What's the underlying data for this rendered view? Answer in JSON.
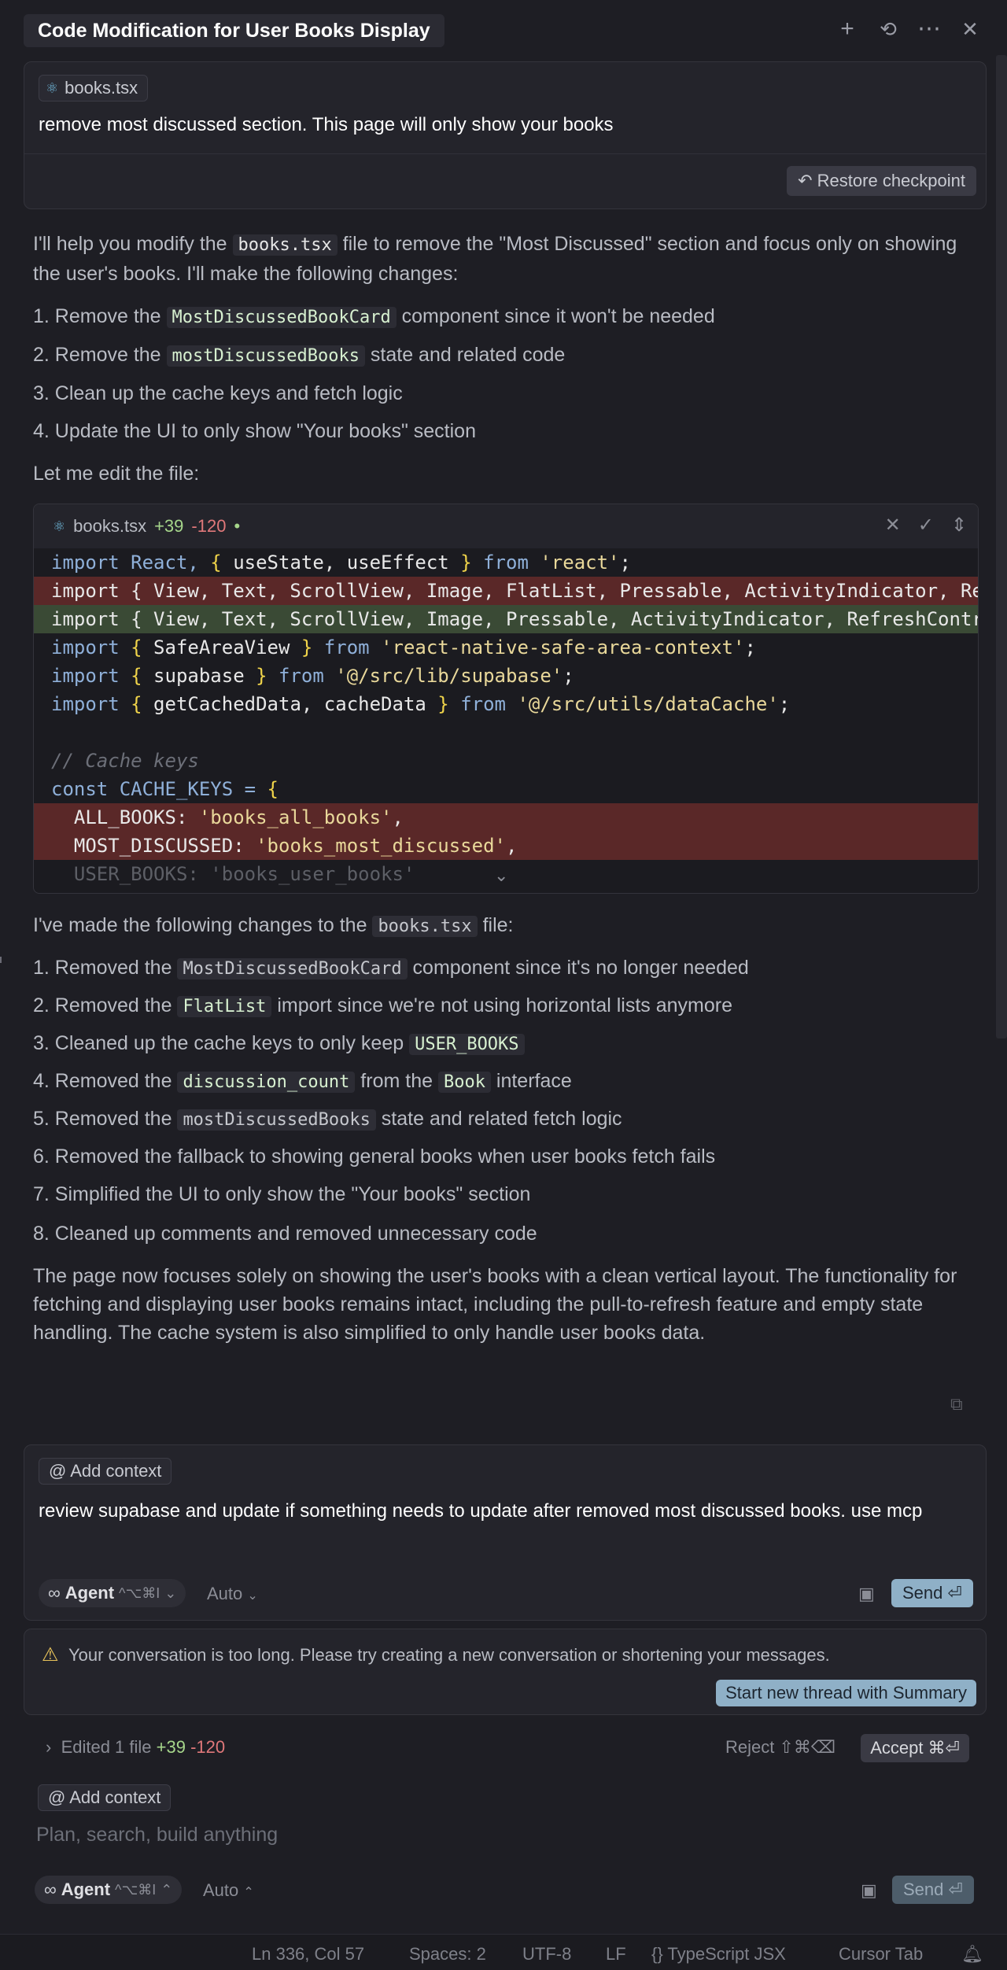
{
  "header": {
    "title": "Code Modification for User Books Display",
    "icons": [
      "plus-icon",
      "history-icon",
      "more-icon",
      "close-icon"
    ]
  },
  "user_message": {
    "file_chip": "books.tsx",
    "text": "remove most discussed section. This page will only show your books",
    "restore_label": "Restore checkpoint"
  },
  "assistant_intro": {
    "p1_a": "I'll help you modify the ",
    "p1_code": "books.tsx",
    "p1_b": " file to remove the \"Most Discussed\" section and focus only on showing the user's books. I'll make the following changes:",
    "steps": [
      {
        "n": "1. ",
        "a": "Remove the ",
        "code": "MostDiscussedBookCard",
        "b": " component since it won't be needed"
      },
      {
        "n": "2. ",
        "a": "Remove the ",
        "code": "mostDiscussedBooks",
        "b": " state and related code"
      },
      {
        "n": "3. ",
        "a": "Clean up the cache keys and fetch logic",
        "code": "",
        "b": ""
      },
      {
        "n": "4. ",
        "a": "Update the UI to only show \"Your books\" section",
        "code": "",
        "b": ""
      }
    ],
    "edit_intro": "Let me edit the file:"
  },
  "code_block": {
    "filename": "books.tsx",
    "added": "+39",
    "removed": "-120",
    "dot": "•",
    "lines": {
      "l1_a": "import React, ",
      "l1_b": "{",
      "l1_c": " useState, useEffect ",
      "l1_d": "}",
      "l1_e": " from ",
      "l1_f": "'react'",
      "l1_g": ";",
      "l2": "import { View, Text, ScrollView, Image, FlatList, Pressable, ActivityIndicator, Re",
      "l3": "import { View, Text, ScrollView, Image, Pressable, ActivityIndicator, RefreshContr",
      "l4_a": "import ",
      "l4_b": "{",
      "l4_c": " SafeAreaView ",
      "l4_d": "}",
      "l4_e": " from ",
      "l4_f": "'react-native-safe-area-context'",
      "l4_g": ";",
      "l5_a": "import ",
      "l5_b": "{",
      "l5_c": " supabase ",
      "l5_d": "}",
      "l5_e": " from ",
      "l5_f": "'@/src/lib/supabase'",
      "l5_g": ";",
      "l6_a": "import ",
      "l6_b": "{",
      "l6_c": " getCachedData, cacheData ",
      "l6_d": "}",
      "l6_e": " from ",
      "l6_f": "'@/src/utils/dataCache'",
      "l6_g": ";",
      "l8": "// Cache keys",
      "l9_a": "const CACHE_KEYS = ",
      "l9_b": "{",
      "l10_a": "  ALL_BOOKS: ",
      "l10_b": "'books_all_books'",
      "l10_c": ",",
      "l11_a": "  MOST_DISCUSSED: ",
      "l11_b": "'books_most_discussed'",
      "l11_c": ",",
      "l12": "  USER_BOOKS: 'books_user_books'"
    }
  },
  "assistant_summary": {
    "p_a": "I've made the following changes to the ",
    "p_code": "books.tsx",
    "p_b": " file:",
    "changes": [
      {
        "n": "1. ",
        "a": "Removed the ",
        "code": "MostDiscussedBookCard",
        "b": " component since it's no longer needed",
        "style": "dim"
      },
      {
        "n": "2. ",
        "a": "Removed the ",
        "code": "FlatList",
        "b": " import since we're not using horizontal lists anymore",
        "style": "green"
      },
      {
        "n": "3. ",
        "a": "Cleaned up the cache keys to only keep ",
        "code": "USER_BOOKS",
        "b": "",
        "style": "green"
      },
      {
        "n": "4. ",
        "a": "Removed the ",
        "code": "discussion_count",
        "b": " from the ",
        "code2": "Book",
        "c": " interface",
        "style": "green"
      },
      {
        "n": "5. ",
        "a": "Removed the ",
        "code": "mostDiscussedBooks",
        "b": " state and related fetch logic",
        "style": "dim"
      },
      {
        "n": "6. ",
        "a": "Removed the fallback to showing general books when user books fetch fails",
        "code": "",
        "b": "",
        "style": "green"
      },
      {
        "n": "7. ",
        "a": "Simplified the UI to only show the \"Your books\" section",
        "code": "",
        "b": "",
        "style": "green"
      },
      {
        "n": "8. ",
        "a": "Cleaned up comments and removed unnecessary code",
        "code": "",
        "b": "",
        "style": "green"
      }
    ],
    "closing": "The page now focuses solely on showing the user's books with a clean vertical layout. The functionality for fetching and displaying user books remains intact, including the pull-to-refresh feature and empty state handling. The cache system is also simplified to only handle user books data."
  },
  "composer": {
    "context_label": "Add context",
    "text": "review supabase and update if something needs to update after removed most discussed books. use mcp",
    "agent_label": "Agent",
    "agent_shortcut": "^⌥⌘I",
    "auto_label": "Auto",
    "send_label": "Send"
  },
  "warning": {
    "text": "Your conversation is too long. Please try creating a new conversation or shortening your messages.",
    "button": "Start new thread with Summary"
  },
  "edited": {
    "label": "Edited 1 file",
    "added": "+39",
    "removed": "-120",
    "reject": "Reject ⇧⌘⌫",
    "accept": "Accept ⌘⏎"
  },
  "composer2": {
    "context_label": "Add context",
    "placeholder": "Plan, search, build anything",
    "agent_label": "Agent",
    "agent_shortcut": "^⌥⌘I",
    "auto_label": "Auto",
    "send_label": "Send"
  },
  "status_bar": {
    "position": "Ln 336, Col 57",
    "spaces": "Spaces: 2",
    "encoding": "UTF-8",
    "eol": "LF",
    "language": "{} TypeScript JSX",
    "cursor_tab": "Cursor Tab"
  }
}
